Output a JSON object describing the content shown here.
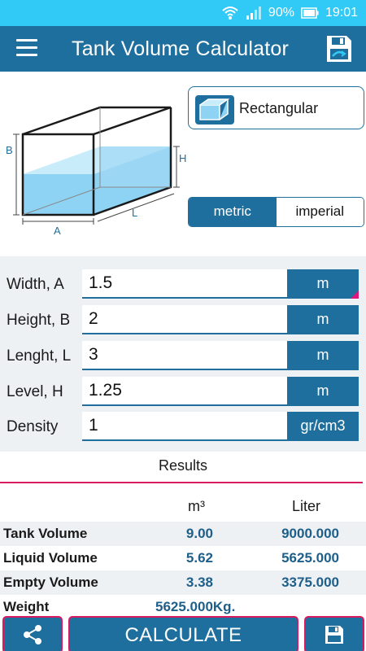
{
  "status_bar": {
    "battery_text": "90%",
    "time": "19:01"
  },
  "app_bar": {
    "title": "Tank Volume Calculator"
  },
  "diagram": {
    "labels": {
      "b": "B",
      "h": "H",
      "a": "A",
      "l": "L"
    }
  },
  "shape_selector": {
    "label": "Rectangular"
  },
  "unit_system": {
    "options": [
      "metric",
      "imperial"
    ],
    "selected": "metric"
  },
  "inputs": [
    {
      "label": "Width, A",
      "value": "1.5",
      "unit": "m"
    },
    {
      "label": "Height, B",
      "value": "2",
      "unit": "m"
    },
    {
      "label": "Lenght, L",
      "value": "3",
      "unit": "m"
    },
    {
      "label": "Level, H",
      "value": "1.25",
      "unit": "m"
    },
    {
      "label": "Density",
      "value": "1",
      "unit": "gr/cm3"
    }
  ],
  "results": {
    "title": "Results",
    "headers": [
      "m³",
      "Liter"
    ],
    "rows": [
      {
        "label": "Tank Volume",
        "m3": "9.00",
        "liter": "9000.000"
      },
      {
        "label": "Liquid Volume",
        "m3": "5.62",
        "liter": "5625.000"
      },
      {
        "label": "Empty Volume",
        "m3": "3.38",
        "liter": "3375.000"
      }
    ],
    "weight": {
      "label": "Weight",
      "value": "5625.000Kg."
    }
  },
  "bottom": {
    "calculate_label": "CALCULATE"
  },
  "colors": {
    "primary": "#1e6f9e",
    "status": "#31c9f5",
    "accent": "#d81b60",
    "water": "#8fd3f4"
  }
}
